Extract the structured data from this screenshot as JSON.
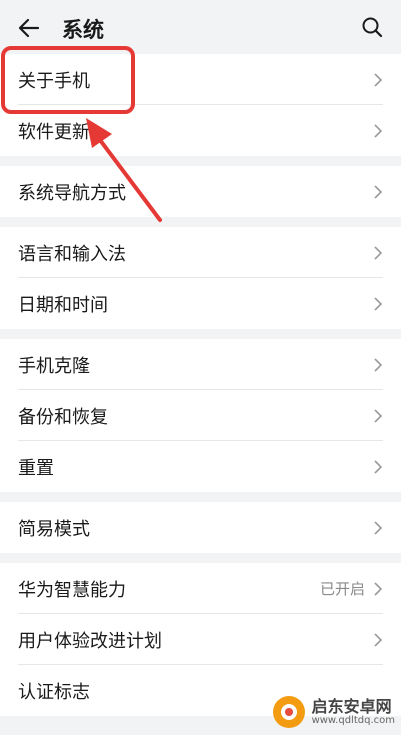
{
  "header": {
    "title": "系统"
  },
  "groups": [
    {
      "items": [
        {
          "label": "关于手机"
        },
        {
          "label": "软件更新"
        }
      ]
    },
    {
      "items": [
        {
          "label": "系统导航方式"
        }
      ]
    },
    {
      "items": [
        {
          "label": "语言和输入法"
        },
        {
          "label": "日期和时间"
        }
      ]
    },
    {
      "items": [
        {
          "label": "手机克隆"
        },
        {
          "label": "备份和恢复"
        },
        {
          "label": "重置"
        }
      ]
    },
    {
      "items": [
        {
          "label": "简易模式"
        }
      ]
    },
    {
      "items": [
        {
          "label": "华为智慧能力",
          "value": "已开启"
        },
        {
          "label": "用户体验改进计划"
        },
        {
          "label": "认证标志"
        }
      ]
    }
  ],
  "watermark": {
    "text": "启东安卓网",
    "url": "www.qdltdq.com"
  },
  "colors": {
    "highlight": "#e53935",
    "background": "#f1f3f5"
  }
}
